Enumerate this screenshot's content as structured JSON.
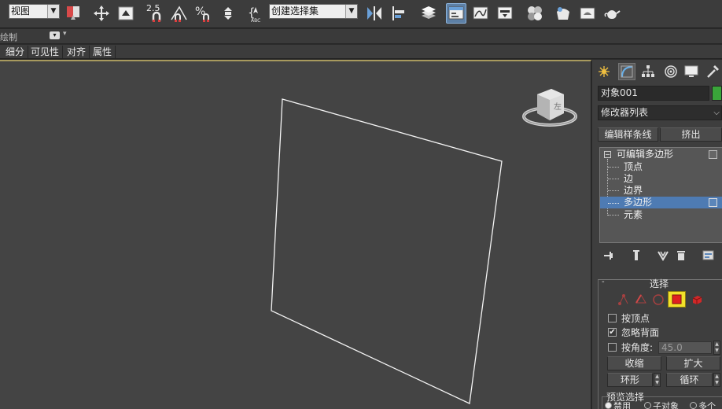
{
  "toolbar": {
    "view_dropdown": "视图",
    "selection_set_dropdown": "创建选择集",
    "angle_snap_label": "2.5"
  },
  "row2": {
    "label": "绘制"
  },
  "ribbon_tabs": [
    "细分",
    "可见性",
    "对齐",
    "属性"
  ],
  "viewcube": {
    "face_label": "左"
  },
  "panel": {
    "object_name": "对象001",
    "object_color": "#3aa53a",
    "modifier_list": "修改器列表",
    "buttons": {
      "edit_spline": "编辑样条线",
      "extrude": "挤出"
    },
    "stack": {
      "root": "可编辑多边形",
      "items": [
        "顶点",
        "边",
        "边界",
        "多边形",
        "元素"
      ],
      "selected": "多边形"
    },
    "selection": {
      "title": "选择",
      "by_vertex": "按顶点",
      "ignore_backface": "忽略背面",
      "by_angle": "按角度:",
      "angle_value": "45.0",
      "shrink": "收缩",
      "grow": "扩大",
      "ring": "环形",
      "loop": "循环",
      "preview_title": "预览选择",
      "preview_off": "禁用",
      "preview_subobj": "子对象",
      "preview_multi": "多个"
    }
  }
}
